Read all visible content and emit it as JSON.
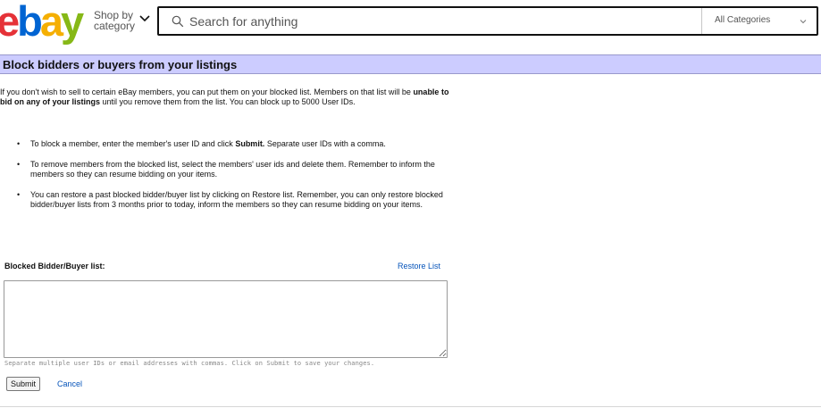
{
  "header": {
    "logo": {
      "letters": [
        "e",
        "b",
        "a",
        "y"
      ],
      "colors": [
        "#e53238",
        "#0064d2",
        "#f5af02",
        "#86b817"
      ]
    },
    "shop_by": {
      "line1": "Shop by",
      "line2": "category",
      "icon": "chevron-down-icon"
    },
    "search": {
      "placeholder": "Search for anything",
      "icon": "search-icon"
    },
    "category_select": {
      "selected": "All Categories",
      "icon": "chevron-down-icon"
    }
  },
  "page": {
    "title": "Block bidders or buyers from your listings",
    "intro_part1": "If you don't wish to sell to certain eBay members, you can put them on your blocked list. Members on that list will be ",
    "intro_bold": "unable to bid on any of your listings",
    "intro_part2": " until you remove them from the list. You can block up to 5000 User IDs.",
    "bullets": [
      {
        "part1": "To block a member, enter the member's user ID and click ",
        "bold": "Submit.",
        "part2": " Separate user IDs with a comma."
      },
      {
        "text": "To remove members from the blocked list, select the members' user ids and delete them. Remember to inform the members so they can resume bidding on your items."
      },
      {
        "text": "You can restore a past blocked bidder/buyer list by clicking on Restore list. Remember, you can only restore blocked bidder/buyer lists from 3 months prior to today, inform the members so they can resume bidding on your items."
      }
    ],
    "blocked_list_label": "Blocked Bidder/Buyer list:",
    "restore_link": "Restore List",
    "textarea_value": "",
    "hint": "Separate multiple user IDs or email addresses with commas. Click on Submit to save your changes.",
    "submit_label": "Submit",
    "cancel_label": "Cancel"
  },
  "colors": {
    "title_bar_bg": "#ccccff",
    "link": "#0654ba"
  }
}
